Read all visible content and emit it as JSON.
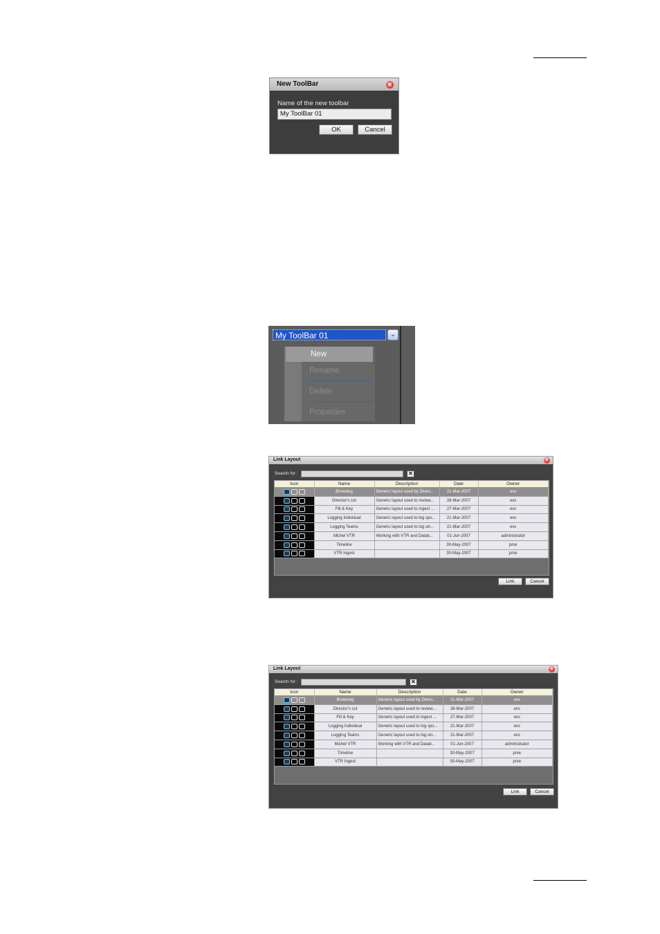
{
  "new_toolbar_dialog": {
    "title": "New ToolBar",
    "label": "Name of the new toolbar",
    "value": "My ToolBar 01",
    "ok": "OK",
    "cancel": "Cancel"
  },
  "toolbar_menu": {
    "selected_toolbar": "My ToolBar 01",
    "items": [
      "New",
      "Rename",
      "Delete",
      "Properties"
    ]
  },
  "link_layout": {
    "title": "Link Layout",
    "search_label": "Search for :",
    "search_value": "",
    "clear": "✕",
    "columns": [
      "Icon",
      "Name",
      "Description",
      "Date",
      "Owner"
    ],
    "rows": [
      {
        "name": "Browsing",
        "description": "Generic layout used by Direct...",
        "date": "21-Mar-2007",
        "owner": "evs"
      },
      {
        "name": "Director's cut",
        "description": "Generic layout used to review...",
        "date": "28-Mar-2007",
        "owner": "evs"
      },
      {
        "name": "Fill & Key",
        "description": "Generic layout used to ingest ...",
        "date": "27-Mar-2007",
        "owner": "evs"
      },
      {
        "name": "Logging Individual",
        "description": "Generic layout used to log spo...",
        "date": "21-Mar-2007",
        "owner": "evs"
      },
      {
        "name": "Logging Teams",
        "description": "Generic layout used to log sin...",
        "date": "21-Mar-2007",
        "owner": "evs"
      },
      {
        "name": "Michel VTR",
        "description": "Working with VTR and Datab...",
        "date": "01-Jun-2007",
        "owner": "administrator"
      },
      {
        "name": "Timeline",
        "description": "",
        "date": "30-May-2007",
        "owner": "pme"
      },
      {
        "name": "VTR Ingest",
        "description": "",
        "date": "30-May-2007",
        "owner": "pme"
      }
    ],
    "link": "Link",
    "cancel": "Cancel"
  },
  "colors": {
    "dialog_bg": "#424242",
    "selection": "#1e55c8",
    "header_bg": "#f3f0dc"
  }
}
